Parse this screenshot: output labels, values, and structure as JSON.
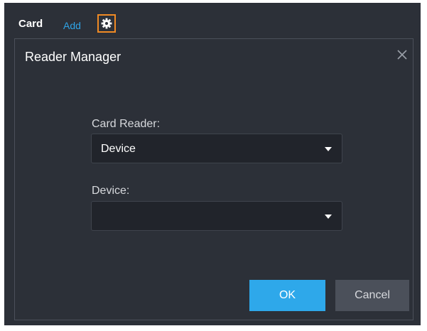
{
  "toolbar": {
    "card_label": "Card",
    "add_label": "Add",
    "settings_icon": "gear-icon"
  },
  "dialog": {
    "title": "Reader Manager",
    "close_icon": "close-icon",
    "card_reader": {
      "label": "Card Reader:",
      "value": "Device"
    },
    "device": {
      "label": "Device:",
      "value": ""
    },
    "ok_label": "OK",
    "cancel_label": "Cancel"
  },
  "colors": {
    "background": "#2c3038",
    "accent": "#2ea8ea",
    "link": "#2fa4e7",
    "highlight_border": "#f08a24"
  }
}
